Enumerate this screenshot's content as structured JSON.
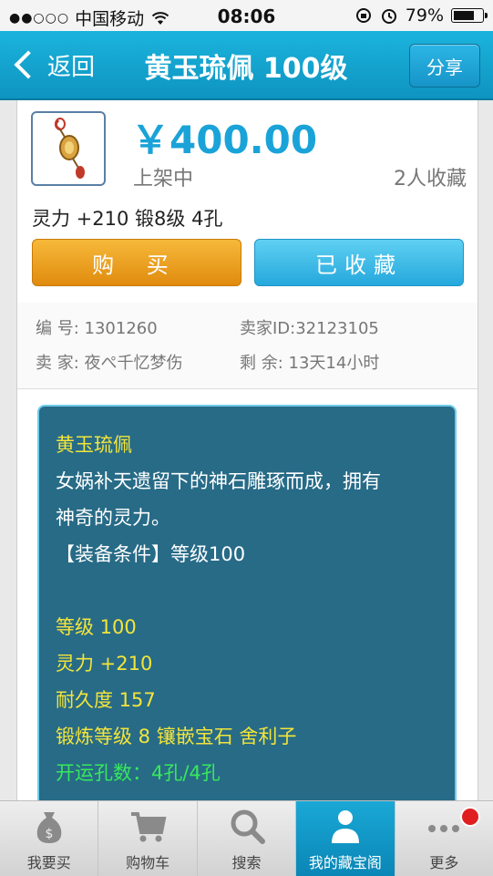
{
  "status_bar": {
    "signal": "●●○○○",
    "carrier": "中国移动",
    "time": "08:06",
    "battery": "79%",
    "battery_level": 0.79
  },
  "nav": {
    "back_label": "返回",
    "title": "黄玉琉佩 100级",
    "share_label": "分享",
    "bg_color": "#1aa6d6"
  },
  "item": {
    "price": "￥400.00",
    "status": "上架中",
    "favorites": "2人收藏",
    "stats": "灵力 +210  锻8级  4孔",
    "buy_label": "购 买",
    "fav_label": "已收藏",
    "price_color": "#1aa3d8"
  },
  "info": {
    "id_label": "编  号:",
    "id_value": "1301260",
    "seller_id_label": "卖家ID:",
    "seller_id_value": "32123105",
    "seller_label": "卖  家:",
    "seller_value": "夜ぺ千忆梦伤",
    "remaining_label": "剩  余:",
    "remaining_value": "13天14小时"
  },
  "description": {
    "name": "黄玉琉佩",
    "line1": "女娲补天遗留下的神石雕琢而成，拥有",
    "line2": "神奇的灵力。",
    "requirement": "【装备条件】等级100",
    "level": "等级 100",
    "spirit": "灵力 +210",
    "durability": "耐久度 157",
    "forge": "锻炼等级 8 镶嵌宝石 舍利子",
    "holes": "开运孔数：4孔/4孔"
  },
  "tabs": [
    {
      "label": "我要买",
      "icon": "money-bag-icon"
    },
    {
      "label": "购物车",
      "icon": "cart-icon"
    },
    {
      "label": "搜索",
      "icon": "search-icon"
    },
    {
      "label": "我的藏宝阁",
      "icon": "user-icon"
    },
    {
      "label": "更多",
      "icon": "more-dots-icon"
    }
  ]
}
